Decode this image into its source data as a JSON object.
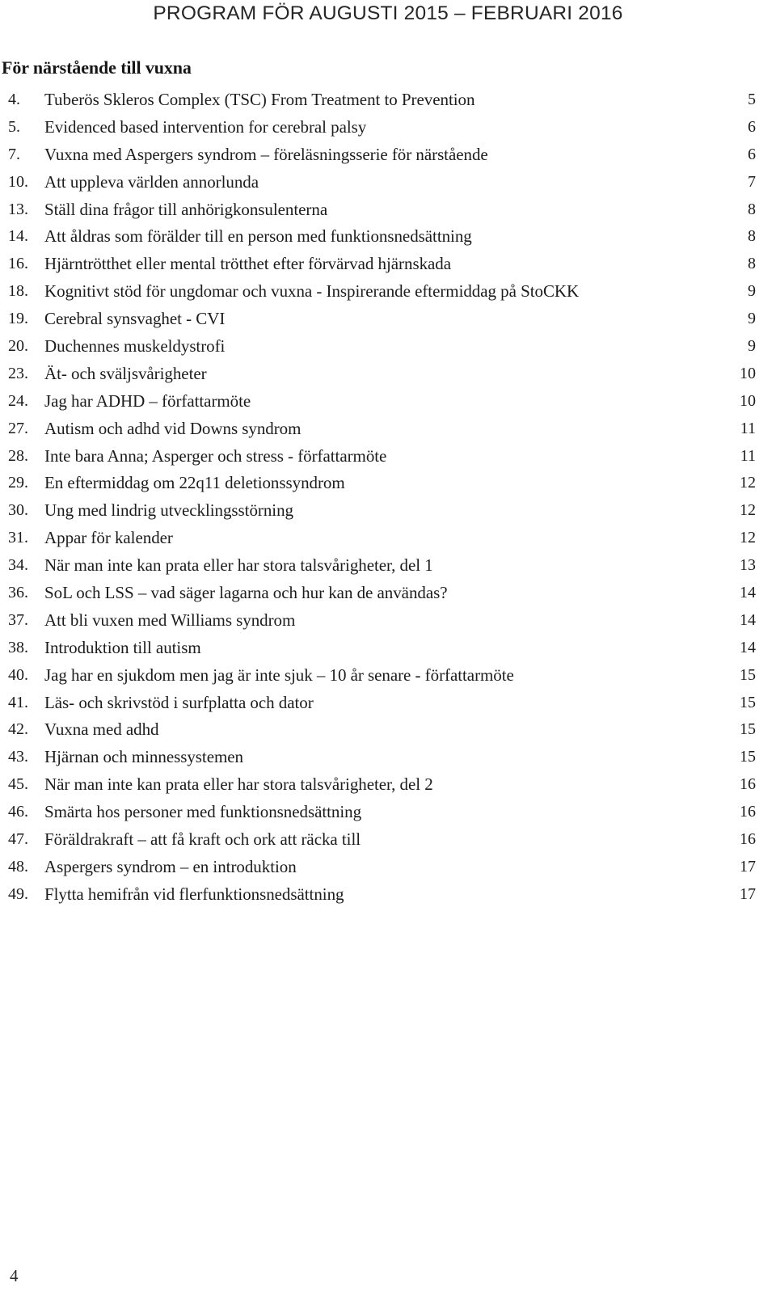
{
  "header": {
    "running_title": "PROGRAM FÖR AUGUSTI 2015 – FEBRUARI 2016"
  },
  "section": {
    "heading": "För närstående till vuxna"
  },
  "footer": {
    "page_number": "4"
  },
  "toc": {
    "items": [
      {
        "num": "4.",
        "title": "Tuberös Skleros Complex (TSC) From Treatment to Prevention",
        "page": "5"
      },
      {
        "num": "5.",
        "title": "Evidenced based intervention for cerebral palsy",
        "page": "6"
      },
      {
        "num": "7.",
        "title": "Vuxna med Aspergers syndrom – föreläsningsserie för närstående",
        "page": "6"
      },
      {
        "num": "10.",
        "title": "Att uppleva världen annorlunda",
        "page": "7"
      },
      {
        "num": "13.",
        "title": "Ställ dina frågor till anhörigkonsulenterna",
        "page": "8"
      },
      {
        "num": "14.",
        "title": "Att åldras som förälder till en person med funktionsnedsättning",
        "page": "8"
      },
      {
        "num": "16.",
        "title": "Hjärntrötthet eller mental trötthet efter förvärvad hjärnskada",
        "page": "8"
      },
      {
        "num": "18.",
        "title": "Kognitivt stöd för ungdomar och vuxna - Inspirerande eftermiddag på StoCKK",
        "page": "9"
      },
      {
        "num": "19.",
        "title": "Cerebral synsvaghet - CVI",
        "page": "9"
      },
      {
        "num": "20.",
        "title": "Duchennes muskeldystrofi",
        "page": "9"
      },
      {
        "num": "23.",
        "title": "Ät- och sväljsvårigheter",
        "page": "10"
      },
      {
        "num": "24.",
        "title": "Jag har ADHD – författarmöte",
        "page": "10"
      },
      {
        "num": "27.",
        "title": "Autism och adhd vid Downs syndrom",
        "page": "11"
      },
      {
        "num": "28.",
        "title": "Inte bara Anna; Asperger och stress - författarmöte",
        "page": "11"
      },
      {
        "num": "29.",
        "title": "En eftermiddag om 22q11 deletionssyndrom",
        "page": "12"
      },
      {
        "num": "30.",
        "title": "Ung med lindrig utvecklingsstörning",
        "page": "12"
      },
      {
        "num": "31.",
        "title": "Appar för kalender",
        "page": "12"
      },
      {
        "num": "34.",
        "title": "När man inte kan prata eller har stora talsvårigheter, del 1",
        "page": "13"
      },
      {
        "num": "36.",
        "title": "SoL och LSS – vad säger lagarna och hur kan de användas?",
        "page": "14"
      },
      {
        "num": "37.",
        "title": "Att bli vuxen med Williams syndrom",
        "page": "14"
      },
      {
        "num": "38.",
        "title": "Introduktion till autism",
        "page": "14"
      },
      {
        "num": "40.",
        "title": "Jag har en sjukdom men jag är inte sjuk – 10 år senare - författarmöte",
        "page": "15"
      },
      {
        "num": "41.",
        "title": "Läs- och skrivstöd i surfplatta och dator",
        "page": "15"
      },
      {
        "num": "42.",
        "title": "Vuxna med adhd",
        "page": "15"
      },
      {
        "num": "43.",
        "title": "Hjärnan och minnessystemen",
        "page": "15"
      },
      {
        "num": "45.",
        "title": "När man inte kan prata eller har stora talsvårigheter, del 2",
        "page": "16"
      },
      {
        "num": "46.",
        "title": "Smärta hos personer med funktionsnedsättning",
        "page": "16"
      },
      {
        "num": "47.",
        "title": "Föräldrakraft – att få kraft och ork att räcka till",
        "page": "16"
      },
      {
        "num": "48.",
        "title": "Aspergers syndrom – en introduktion",
        "page": "17"
      },
      {
        "num": "49.",
        "title": "Flytta hemifrån vid flerfunktionsnedsättning",
        "page": "17"
      }
    ]
  }
}
